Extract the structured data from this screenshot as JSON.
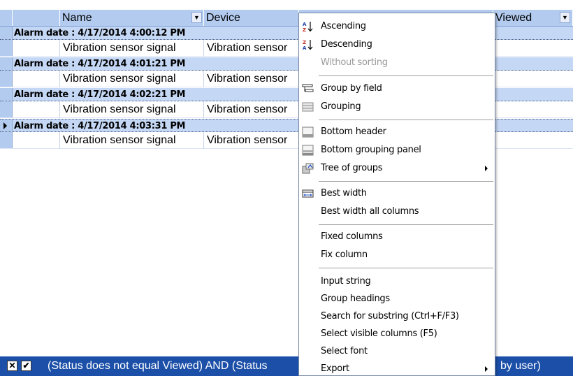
{
  "grid": {
    "columns": {
      "name": "Name",
      "device": "Device",
      "viewed": "Viewed"
    },
    "groups": [
      {
        "label": "Alarm date : 4/17/2014 4:00:12 PM",
        "row": {
          "name": "Vibration sensor signal",
          "device": "Vibration sensor"
        }
      },
      {
        "label": "Alarm date : 4/17/2014 4:01:21 PM",
        "row": {
          "name": "Vibration sensor signal",
          "device": "Vibration sensor"
        }
      },
      {
        "label": "Alarm date : 4/17/2014 4:02:21 PM",
        "row": {
          "name": "Vibration sensor signal",
          "device": "Vibration sensor"
        }
      },
      {
        "label": "Alarm date : 4/17/2014 4:03:31 PM",
        "row": {
          "name": "Vibration sensor signal",
          "device": "Vibration sensor"
        },
        "active": true
      }
    ]
  },
  "filter": {
    "close_glyph": "✕",
    "check_glyph": "✔",
    "text_left": "(Status does not equal Viewed) AND (Status",
    "text_right": "by user)"
  },
  "menu": {
    "items": [
      {
        "label": "Ascending",
        "icon": "sort-ascending-icon"
      },
      {
        "label": "Descending",
        "icon": "sort-descending-icon"
      },
      {
        "label": "Without sorting",
        "disabled": true
      },
      {
        "label": "Group by field",
        "icon": "group-by-field-icon"
      },
      {
        "label": "Grouping",
        "icon": "grouping-icon"
      },
      {
        "label": "Bottom header",
        "icon": "bottom-header-icon"
      },
      {
        "label": "Bottom grouping panel",
        "icon": "bottom-grouping-panel-icon"
      },
      {
        "label": "Tree of groups",
        "icon": "tree-of-groups-icon",
        "submenu": true
      },
      {
        "label": "Best width",
        "icon": "best-width-icon"
      },
      {
        "label": "Best width all columns"
      },
      {
        "label": "Fixed columns"
      },
      {
        "label": "Fix column"
      },
      {
        "label": "Input string"
      },
      {
        "label": "Group headings"
      },
      {
        "label": "Search for substring (Ctrl+F/F3)"
      },
      {
        "label": "Select visible columns (F5)"
      },
      {
        "label": "Select font"
      },
      {
        "label": "Export",
        "submenu": true
      }
    ]
  },
  "colors": {
    "header_bg": "#b3cbef",
    "group_bg": "#c4d7f4",
    "filter_bar_bg": "#1b4fa8"
  }
}
